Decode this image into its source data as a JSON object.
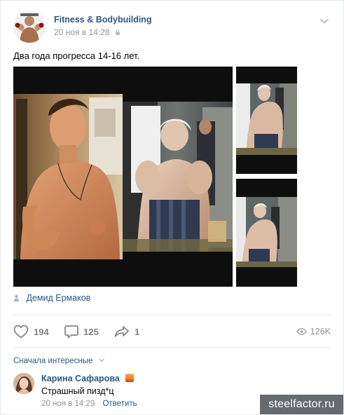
{
  "post": {
    "author": "Fitness & Bodybuilding",
    "date": "20 ноя в 14:28",
    "text": "Два года прогресса 14-16 лет.",
    "signature": "Демид Ермаков"
  },
  "actions": {
    "likes": "194",
    "comments": "125",
    "shares": "1",
    "views": "126K"
  },
  "comments": {
    "sort_label": "Сначала интересные",
    "items": [
      {
        "author": "Карина Сафарова",
        "text": "Страшный пизд*ц",
        "date": "20 ноя в 14:29",
        "reply_label": "Ответить"
      }
    ]
  },
  "watermark": "steelfactor.ru",
  "icons": {
    "header_menu": "chevron-down-icon",
    "privacy": "lock-icon",
    "signature": "person-icon",
    "like": "heart-icon",
    "comment": "comment-bubble-icon",
    "share": "share-arrow-icon",
    "views": "eye-icon"
  },
  "colors": {
    "link": "#2a5885",
    "muted": "#939393",
    "action": "#828282",
    "divider": "#e7e8ec"
  }
}
